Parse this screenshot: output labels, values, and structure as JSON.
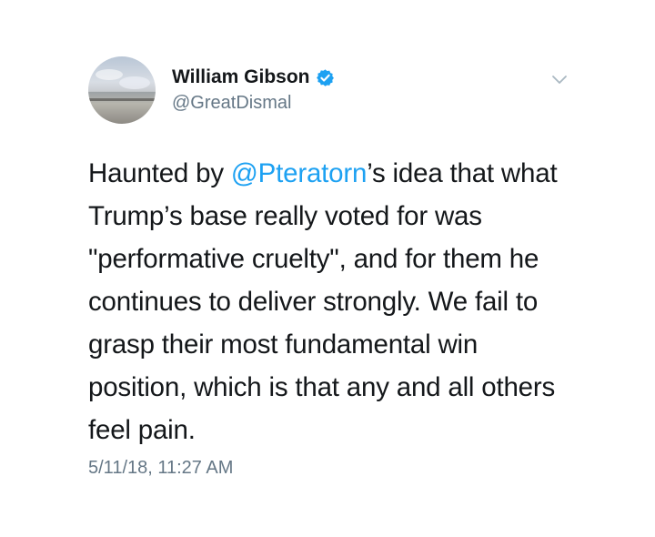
{
  "author": {
    "name": "William Gibson",
    "handle": "@GreatDismal",
    "verified_color": "#1da1f2"
  },
  "tweet": {
    "lines": [
      {
        "before": "Haunted by ",
        "mention": "@Pteratorn",
        "after": "’s idea that what"
      },
      {
        "text": "Trump’s base really voted for was"
      },
      {
        "text": "\"performative cruelty\", and for them he"
      },
      {
        "text": "continues to deliver strongly. We fail to"
      },
      {
        "text": "grasp their most fundamental win"
      },
      {
        "text": "position, which is that any and all others"
      },
      {
        "text": "feel pain."
      }
    ],
    "timestamp": "5/11/18, 11:27 AM"
  },
  "icons": {
    "verified": "verified-badge-icon",
    "menu": "chevron-down-icon"
  },
  "colors": {
    "text": "#14171a",
    "secondary": "#657786",
    "link": "#1da1f2"
  }
}
